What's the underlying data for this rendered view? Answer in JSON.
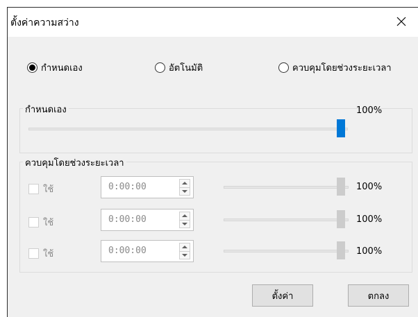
{
  "dialog": {
    "title": "ตั้งค่าความสว่าง"
  },
  "modes": [
    {
      "label": "กำหนดเอง",
      "selected": true
    },
    {
      "label": "อัตโนมัติ",
      "selected": false
    },
    {
      "label": "ควบคุมโดยช่วงระยะเวลา",
      "selected": false
    }
  ],
  "manual_group": {
    "label": "กำหนดเอง",
    "percent_text": "100%",
    "value": 1.0
  },
  "schedule_group": {
    "label": "ควบคุมโดยช่วงระยะเวลา",
    "rows": [
      {
        "use_label": "ใช้",
        "checked": false,
        "time": "0:00:00",
        "percent_text": "100%",
        "value": 1.0
      },
      {
        "use_label": "ใช้",
        "checked": false,
        "time": "0:00:00",
        "percent_text": "100%",
        "value": 1.0
      },
      {
        "use_label": "ใช้",
        "checked": false,
        "time": "0:00:00",
        "percent_text": "100%",
        "value": 1.0
      }
    ]
  },
  "buttons": {
    "apply": "ตั้งค่า",
    "ok": "ตกลง"
  },
  "colors": {
    "accent": "#0078d7",
    "disabled_thumb": "#cccccc",
    "dialog_bg": "#f0f0f0"
  },
  "icons": {
    "close": "close-icon",
    "spin_up": "spin-up-icon",
    "spin_down": "spin-down-icon"
  }
}
